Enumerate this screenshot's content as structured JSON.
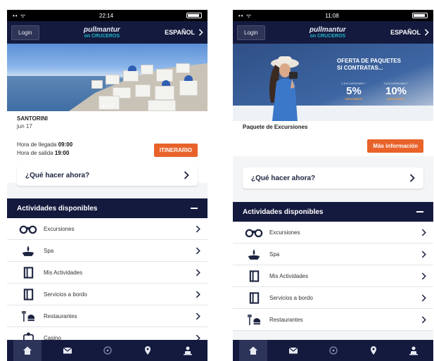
{
  "screens": [
    {
      "status": {
        "left": "•• ᯤ",
        "time": "22:14"
      },
      "header": {
        "login": "Login",
        "brand_top": "pullmantur",
        "brand_bottom": "on CRUCEROS",
        "language": "ESPAÑOL"
      },
      "port": {
        "name": "SANTORINI",
        "date": "jun 17",
        "arrival_label": "Hora de llegada",
        "arrival_time": "09:00",
        "departure_label": "Hora de salida",
        "departure_time": "19:00",
        "itinerary_button": "ITINERARIO"
      },
      "what_now": "¿Qué hacer ahora?",
      "activities": {
        "title": "Actividades disponibles",
        "items": [
          {
            "label": "Excursiones",
            "icon": "binoculars-icon"
          },
          {
            "label": "Spa",
            "icon": "spa-icon"
          },
          {
            "label": "Mis Actividades",
            "icon": "book-icon"
          },
          {
            "label": "Servicios a bordo",
            "icon": "book-icon"
          },
          {
            "label": "Restaurantes",
            "icon": "restaurant-icon"
          },
          {
            "label": "Casino",
            "icon": "casino-icon"
          }
        ]
      }
    },
    {
      "status": {
        "left": "•• ᯤ",
        "time": "11:08"
      },
      "header": {
        "login": "Login",
        "brand_top": "pullmantur",
        "brand_bottom": "on CRUCEROS",
        "language": "ESPAÑOL"
      },
      "promo": {
        "title_line1": "OFERTA DE PAQUETES",
        "title_line2": "SI CONTRATAS...",
        "col1_caption": "2 EXCURSIONES *",
        "col1_pct": "5%",
        "col1_sub": "DESCUENTO",
        "col2_caption": "3 EXCURSIONES *",
        "col2_pct": "10%",
        "col2_sub": "DESCUENTO"
      },
      "package_title": "Paquete de Excursiones",
      "more_info_button": "Más información",
      "what_now": "¿Qué hacer ahora?",
      "activities": {
        "title": "Actividades disponibles",
        "items": [
          {
            "label": "Excursiones",
            "icon": "binoculars-icon"
          },
          {
            "label": "Spa",
            "icon": "spa-icon"
          },
          {
            "label": "Mis Actividades",
            "icon": "book-icon"
          },
          {
            "label": "Servicios a bordo",
            "icon": "book-icon"
          },
          {
            "label": "Restaurantes",
            "icon": "restaurant-icon"
          }
        ]
      }
    }
  ],
  "tabbar": [
    "home-icon",
    "mail-icon",
    "compass-icon",
    "location-pin-icon",
    "people-icon"
  ],
  "colors": {
    "navy": "#141a3e",
    "orange": "#e8622a",
    "teal": "#1fb6c9"
  }
}
